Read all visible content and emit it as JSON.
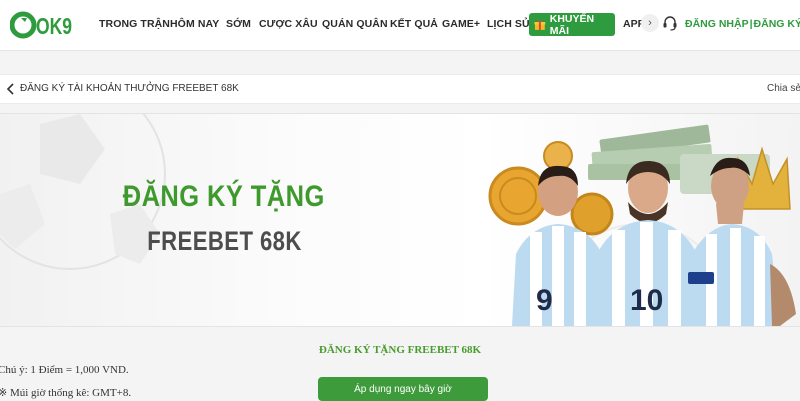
{
  "brand": {
    "logo_text": "OK9",
    "color": "#2e9b3e"
  },
  "nav": {
    "items": [
      {
        "label": "TRONG TRẬN"
      },
      {
        "label": "HÔM NAY"
      },
      {
        "label": "SỚM"
      },
      {
        "label": "CƯỢC XÂU"
      },
      {
        "label": "QUÁN QUÂN"
      },
      {
        "label": "KẾT QUẢ"
      },
      {
        "label": "GAME+"
      },
      {
        "label": "LỊCH SỬ"
      }
    ],
    "promo_label": "KHUYẾN MÃI",
    "promo_icon": "gift-icon",
    "app_label": "APP",
    "support_icon": "headset-icon",
    "login_label": "ĐĂNG NHẬP",
    "auth_separator": "|",
    "register_label": "ĐĂNG KÝ"
  },
  "breadcrumb": {
    "back_icon": "chevron-left-icon",
    "title": "ĐĂNG KÝ TÀI KHOẢN THƯỞNG FREEBET 68K",
    "share_label": "Chia sẻ"
  },
  "banner": {
    "title": "ĐĂNG KÝ TẶNG",
    "subtitle": "FREEBET 68K",
    "jersey_numbers": [
      "9",
      "10"
    ],
    "title_color": "#3f9a2e"
  },
  "content": {
    "heading": "ĐĂNG KÝ TẶNG FREEBET 68K",
    "note1": "Chú ý: 1 Điểm = 1,000 VND.",
    "note2": "※ Múi giờ thống kê: GMT+8.",
    "cta_label": "Áp dụng ngay bây giờ"
  }
}
